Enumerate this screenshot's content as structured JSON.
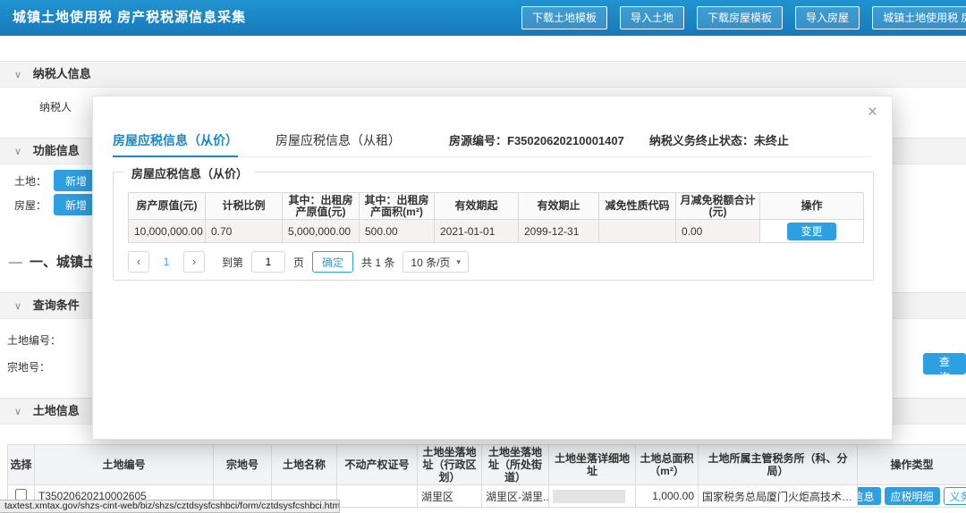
{
  "icons": {
    "chevron": "∨",
    "caret": "▾",
    "close": "×",
    "prev": "‹",
    "next": "›",
    "dash": "—"
  },
  "colors": {
    "header_blue": "#1a86c8",
    "accent_blue": "#2e9fe0"
  },
  "header": {
    "title": "城镇土地使用税 房产税税源信息采集",
    "buttons": [
      "下载土地模板",
      "导入土地",
      "下载房屋模板",
      "导入房屋",
      "城镇土地使用税 房产税申报"
    ]
  },
  "page": {
    "sections": {
      "taxpayer": "纳税人信息",
      "function": "功能信息",
      "query": "查询条件",
      "land": "土地信息"
    },
    "taxpayer_label": "纳税人",
    "land_label": "土地：",
    "house_label": "房屋：",
    "land_add_button": "新增",
    "house_add_button": "新增",
    "section_one_title": "一、城镇土",
    "land_no_label": "土地编号：",
    "parcel_no_label": "宗地号：",
    "query_button": "查询"
  },
  "land_table": {
    "headers": [
      "选择",
      "土地编号",
      "宗地号",
      "土地名称",
      "不动产权证号",
      "土地坐落地址（行政区划）",
      "土地坐落地址（所处街道）",
      "土地坐落详细地址",
      "土地总面积（m²）",
      "土地所属主管税务所（科、分局）",
      "操作类型"
    ],
    "row": {
      "land_no": "T35020620210002605",
      "parcel_no": "",
      "land_name": "",
      "cert_no": "",
      "district": "湖里区",
      "street": "湖里区-湖里...",
      "total_area": "1,000.00",
      "tax_office": "国家税务总局厦门火炬高技术产业...",
      "action_basic": "基本信息",
      "action_detail": "应税明细",
      "action_terminate": "义务终止"
    }
  },
  "modal": {
    "tabs": [
      "房屋应税信息（从价）",
      "房屋应税信息（从租）"
    ],
    "house_code": "房源编号：F35020620210001407",
    "termination_status": "纳税义务终止状态：未终止",
    "group_title": "房屋应税信息（从价）",
    "table": {
      "headers": [
        "房产原值(元)",
        "计税比例",
        "其中：出租房产原值(元)",
        "其中：出租房产面积(m²)",
        "有效期起",
        "有效期止",
        "减免性质代码",
        "月减免税额合计(元)",
        "操作"
      ],
      "row": {
        "original_value": "10,000,000.00",
        "tax_ratio": "0.70",
        "rented_value": "5,000,000.00",
        "rented_area": "500.00",
        "valid_from": "2021-01-01",
        "valid_to": "2099-12-31",
        "deduction_code": "",
        "monthly_deduction_total": "0.00",
        "action": "变更"
      }
    },
    "pagination": {
      "page": "1",
      "goto_prefix": "到第",
      "page_input": "1",
      "goto_suffix": "页",
      "confirm": "确定",
      "total": "共 1 条",
      "page_size": "10 条/页"
    }
  },
  "statusbar": {
    "url": "taxtest.xmtax.gov/shzs-cint-web/biz/shzs/cztdsysfcshbci/form/cztdsysfcshbci.html#"
  }
}
